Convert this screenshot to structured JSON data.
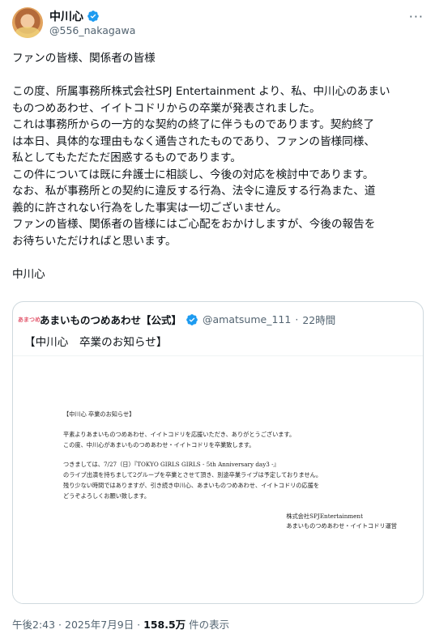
{
  "author": {
    "display_name": "中川心",
    "handle": "@556_nakagawa",
    "more_label": "···"
  },
  "tweet": {
    "lines": [
      "ファンの皆様、関係者の皆様",
      "",
      "この度、所属事務所株式会社SPJ Entertainment より、私、中川心のあまい",
      "ものつめあわせ、イイトコドリからの卒業が発表されました。",
      "これは事務所からの一方的な契約の終了に伴うものであります。契約終了",
      "は本日、具体的な理由もなく通告されたものであり、ファンの皆様同様、",
      "私としてもただただ困惑するものであります。",
      "この件については既に弁護士に相談し、今後の対応を検討中であります。",
      "なお、私が事務所との契約に違反する行為、法令に違反する行為また、道",
      "義的に許されない行為をした事実は一切ございません。",
      "ファンの皆様、関係者の皆様にはご心配をおかけしますが、今後の報告を",
      "お待ちいただければと思います。",
      "",
      "中川心"
    ]
  },
  "quote": {
    "logo_text": "あまつめ",
    "display_name": "あまいものつめあわせ【公式】",
    "handle": "@amatsume_111",
    "separator": "·",
    "time": "22時間",
    "text": "【中川心　卒業のお知らせ】",
    "notice": {
      "title": "【中川心 卒業のお知らせ】",
      "p1": [
        "平素よりあまいものつめあわせ、イイトコドリを応援いただき、ありがとうございます。",
        "この度、中川心があまいものつめあわせ・イイトコドリを卒業致します。"
      ],
      "p2": [
        "つきましては、7/27（日）『TOKYO GIRLS GIRLS - 5th Anniversary day3 -』",
        "のライブ出演を持ちまして2グループを卒業とさせて頂き、別途卒業ライブは予定しておりません。",
        "残り少ない時間ではありますが、引き続き中川心、あまいものつめあわせ、イイトコドリの応援を",
        "どうぞよろしくお願い致します。"
      ],
      "sign1": "株式会社SPJEntertainment",
      "sign2": "あまいものつめあわせ・イイトコドリ運営"
    }
  },
  "footer": {
    "timestamp": "午後2:43 · 2025年7月9日 · ",
    "views_count": "158.5万",
    "views_label": " 件の表示"
  },
  "colors": {
    "verified": "#1d9bf0",
    "text": "#0f1419",
    "secondary": "#536471",
    "border": "#cfd9de"
  },
  "icons": {
    "verified": "verified-badge-icon",
    "more": "more-icon"
  }
}
